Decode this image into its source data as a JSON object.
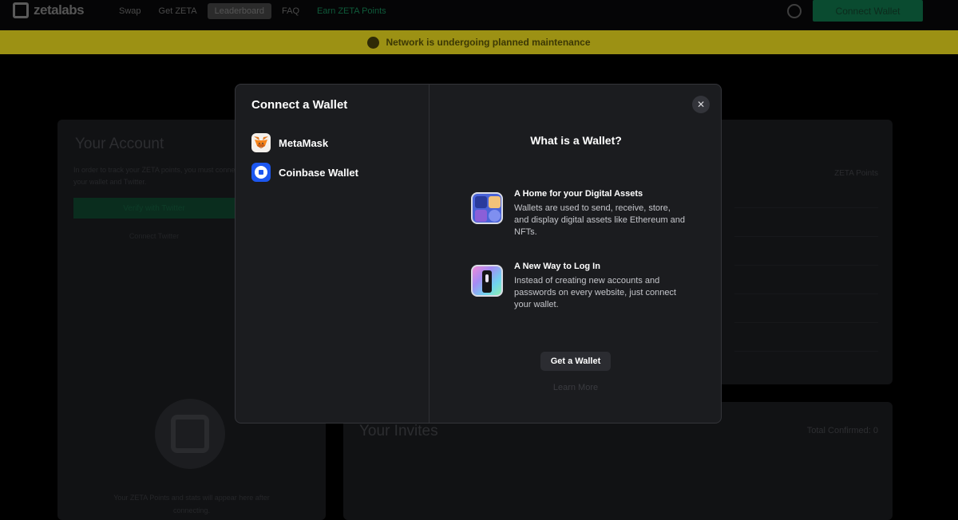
{
  "header": {
    "logo_text": "zetalabs",
    "nav": [
      "Swap",
      "Get ZETA",
      "Leaderboard",
      "FAQ",
      "Earn ZETA Points"
    ],
    "connect_button": "Connect Wallet"
  },
  "banner": {
    "text": "Network is undergoing planned maintenance"
  },
  "account_card": {
    "title": "Your Account",
    "description": "In order to track your ZETA points, you must connect your wallet and Twitter.",
    "verify_button": "Verify with Twitter",
    "connect_link": "Connect Twitter",
    "note": "Your ZETA Points and stats will appear here after connecting."
  },
  "points_card": {
    "points_label": "ZETA Points"
  },
  "invites_card": {
    "title": "Your Invites",
    "total": "Total Confirmed: 0"
  },
  "modal": {
    "title": "Connect a Wallet",
    "wallets": [
      {
        "label": "MetaMask",
        "icon": "metamask-fox-icon"
      },
      {
        "label": "Coinbase Wallet",
        "icon": "coinbase-icon"
      }
    ],
    "info_title": "What is a Wallet?",
    "features": [
      {
        "title": "A Home for your Digital Assets",
        "description": "Wallets are used to send, receive, store, and display digital assets like Ethereum and NFTs.",
        "icon": "digital-assets-icon"
      },
      {
        "title": "A New Way to Log In",
        "description": "Instead of creating new accounts and passwords on every website, just connect your wallet.",
        "icon": "login-key-icon"
      }
    ],
    "get_wallet_button": "Get a Wallet",
    "learn_more_link": "Learn More",
    "close_icon": "close-icon"
  },
  "colors": {
    "modal_bg": "#1b1c1f",
    "banner_bg": "#9c9114",
    "primary_green": "#0a4b30",
    "coinbase_blue": "#1c57f0"
  }
}
